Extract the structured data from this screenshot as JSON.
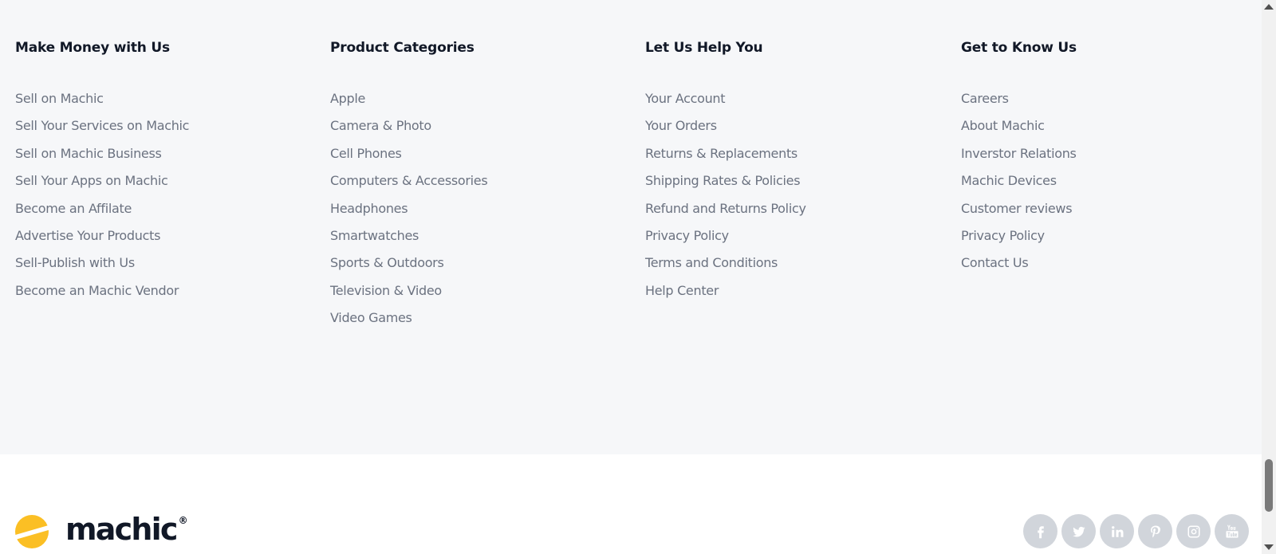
{
  "columns": [
    {
      "title": "Make Money with Us",
      "links": [
        "Sell on Machic",
        "Sell Your Services on Machic",
        "Sell on Machic Business",
        "Sell Your Apps on Machic",
        "Become an Affilate",
        "Advertise Your Products",
        "Sell-Publish with Us",
        "Become an Machic Vendor"
      ]
    },
    {
      "title": "Product Categories",
      "links": [
        "Apple",
        "Camera & Photo",
        "Cell Phones",
        "Computers & Accessories",
        "Headphones",
        "Smartwatches",
        "Sports & Outdoors",
        "Television & Video",
        "Video Games"
      ]
    },
    {
      "title": "Let Us Help You",
      "links": [
        "Your Account",
        "Your Orders",
        "Returns & Replacements",
        "Shipping Rates & Policies",
        "Refund and Returns Policy",
        "Privacy Policy",
        "Terms and Conditions",
        "Help Center"
      ]
    },
    {
      "title": "Get to Know Us",
      "links": [
        "Careers",
        "About Machic",
        "Inverstor Relations",
        "Machic Devices",
        "Customer reviews",
        "Privacy Policy",
        "Contact Us"
      ]
    }
  ],
  "brand": {
    "name": "machic",
    "registered": "®",
    "accent_color": "#fbbf24",
    "text_color": "#111827"
  },
  "socials": [
    {
      "icon": "facebook-icon"
    },
    {
      "icon": "twitter-icon"
    },
    {
      "icon": "linkedin-icon"
    },
    {
      "icon": "pinterest-icon"
    },
    {
      "icon": "instagram-icon"
    },
    {
      "icon": "youtube-icon"
    }
  ],
  "colors": {
    "footer_bg": "#f6f7f9",
    "link": "#6b7280",
    "heading": "#111827",
    "social_bg": "#d1d5db"
  }
}
